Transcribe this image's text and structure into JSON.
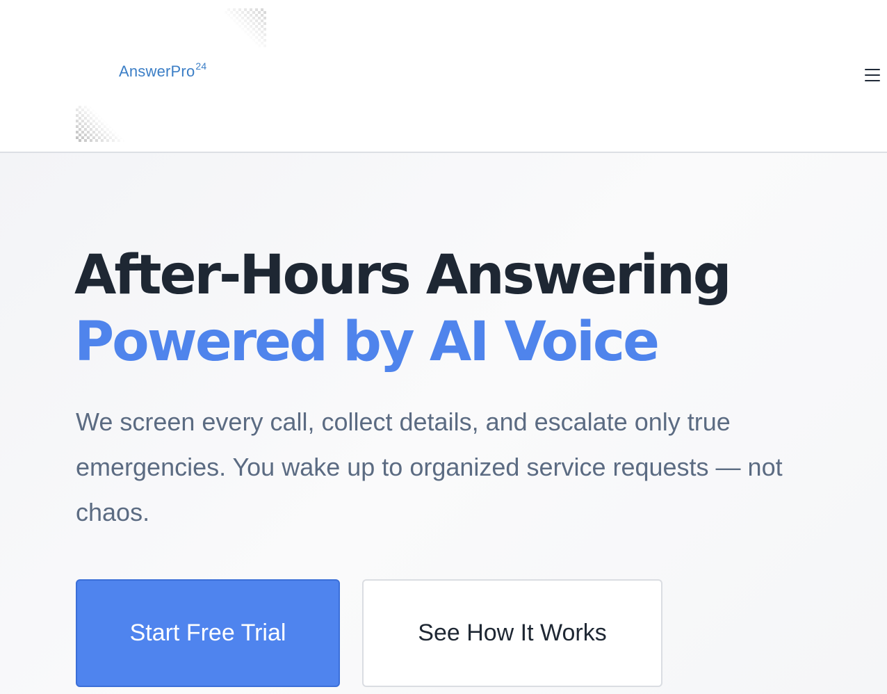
{
  "header": {
    "logo": {
      "name": "AnswerPro",
      "superscript": "24",
      "color": "#3b7ec6"
    },
    "menu_icon": "hamburger-menu-icon"
  },
  "hero": {
    "title_line1": "After-Hours Answering",
    "title_line2": "Powered by AI Voice",
    "subtitle": "We screen every call, collect details, and escalate only true emergencies. You wake up to organized service requests — not chaos.",
    "primary_button": "Start Free Trial",
    "secondary_button": "See How It Works"
  },
  "colors": {
    "heading": "#1e2733",
    "accent": "#4f84ec",
    "body_text": "#5b6b82",
    "primary_button_bg": "#4f84ee"
  }
}
